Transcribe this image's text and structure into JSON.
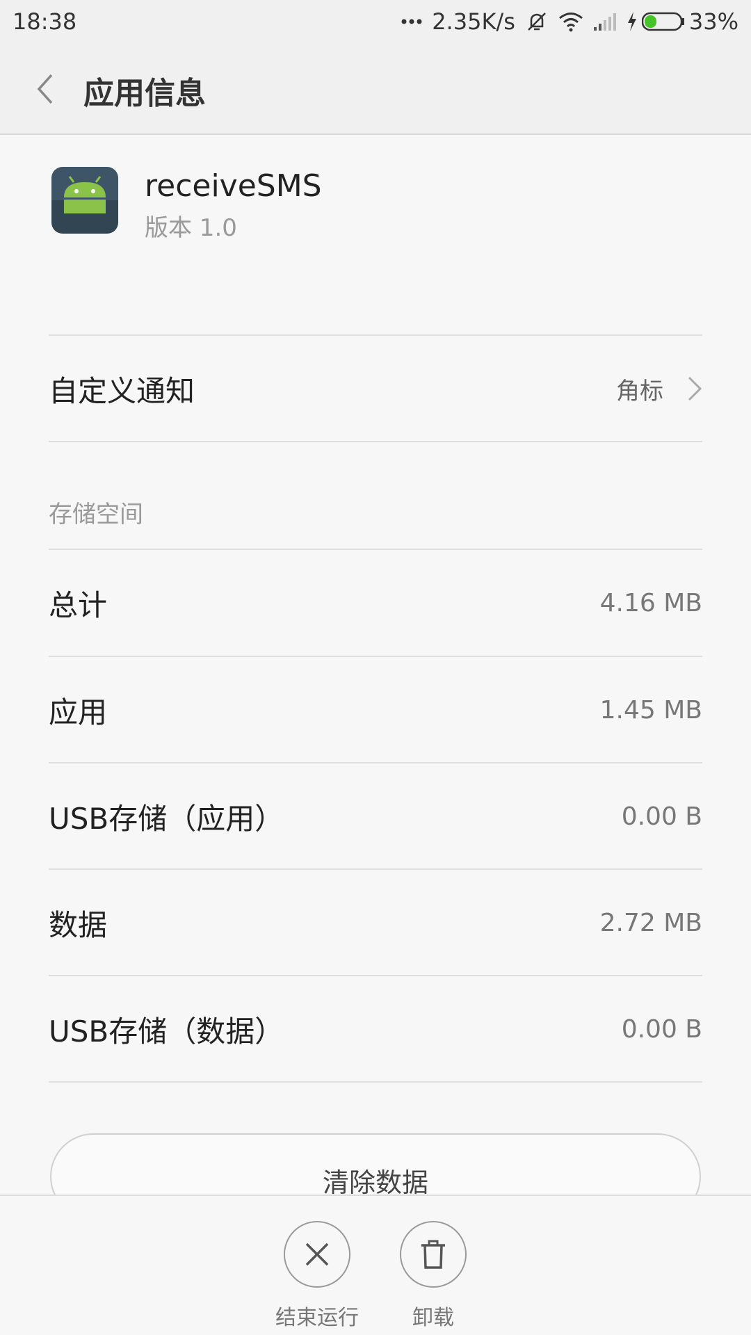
{
  "status_bar": {
    "time": "18:38",
    "network_speed": "2.35K/s",
    "battery_percent": "33%",
    "battery_level": 0.33,
    "battery_color": "#45c52a",
    "icons": [
      "more-dots-icon",
      "mute-icon",
      "wifi-icon",
      "signal-icon",
      "charging-icon",
      "battery-icon"
    ]
  },
  "header": {
    "title": "应用信息"
  },
  "app": {
    "name": "receiveSMS",
    "version": "版本 1.0",
    "icon": "android-robot-icon",
    "icon_color": "#8bc34a"
  },
  "notification": {
    "label": "自定义通知",
    "value": "角标"
  },
  "storage": {
    "section_title": "存储空间",
    "rows": [
      {
        "label": "总计",
        "value": "4.16 MB"
      },
      {
        "label": "应用",
        "value": "1.45 MB"
      },
      {
        "label": "USB存储（应用）",
        "value": "0.00 B"
      },
      {
        "label": "数据",
        "value": "2.72 MB"
      },
      {
        "label": "USB存储（数据）",
        "value": "0.00 B"
      }
    ]
  },
  "clear_data_button": "清除数据",
  "bottom_actions": [
    {
      "label": "结束运行",
      "icon": "close-icon"
    },
    {
      "label": "卸载",
      "icon": "trash-icon"
    }
  ]
}
